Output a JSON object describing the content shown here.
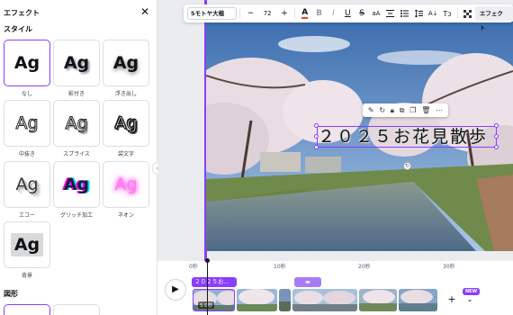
{
  "panel": {
    "title": "エフェクト",
    "close_icon": "close-icon",
    "style_heading": "スタイル",
    "shape_heading": "図形",
    "effects": [
      {
        "label": "なし",
        "sample": "Ag"
      },
      {
        "label": "影付き",
        "sample": "Ag"
      },
      {
        "label": "浮き出し",
        "sample": "Ag"
      },
      {
        "label": "中抜き",
        "sample": "Ag"
      },
      {
        "label": "スプライス",
        "sample": "Ag"
      },
      {
        "label": "袋文字",
        "sample": "Ag"
      },
      {
        "label": "エコー",
        "sample": "Ag"
      },
      {
        "label": "グリッチ加工",
        "sample": "Ag"
      },
      {
        "label": "ネオン",
        "sample": "Ag"
      },
      {
        "label": "背景",
        "sample": "Ag"
      }
    ]
  },
  "toolbar": {
    "font_name": "Sモトヤ大楷",
    "minus": "−",
    "font_size": "72",
    "plus": "+",
    "text_color_glyph": "A",
    "bold": "B",
    "italic": "I",
    "underline": "U",
    "strike": "S",
    "case": "aA",
    "effect_button": "エフェクト"
  },
  "canvas": {
    "title_text": "２０２５お花見散歩"
  },
  "timeline": {
    "ticks": [
      "0秒",
      "10秒",
      "20秒",
      "30秒"
    ],
    "text_track_label": "２０２５お...",
    "clip_duration": "5.0秒",
    "new_badge": "NEW",
    "add_symbol": "+"
  },
  "colors": {
    "accent": "#8b3dff",
    "panel_bg": "#ffffff",
    "workspace_bg": "#ebecf0"
  }
}
